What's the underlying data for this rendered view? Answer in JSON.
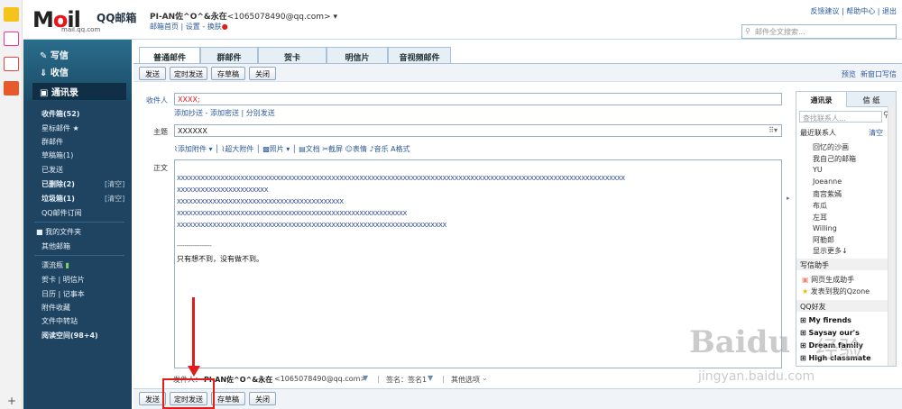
{
  "brand": {
    "logo_text_1": "M",
    "logo_o": "o",
    "logo_text_2": "il",
    "logo_sub": "mail.qq.com",
    "name": "QQ邮箱"
  },
  "account": {
    "nickname": "PI-AN佐^O^&永在",
    "email": "<1065078490@qq.com>",
    "links": [
      "邮箱首页",
      "设置",
      "换肤"
    ]
  },
  "top_links": [
    "反馈建议",
    "帮助中心",
    "退出"
  ],
  "search": {
    "placeholder": "邮件全文搜索..."
  },
  "sidebar": {
    "compose": "写信",
    "inbox": "收信",
    "contacts": "通讯录",
    "folders": [
      {
        "label": "收件箱(52)",
        "bold": true
      },
      {
        "label": "星标邮件 ★"
      },
      {
        "label": "群邮件"
      },
      {
        "label": "草稿箱(1)"
      },
      {
        "label": "已发送"
      },
      {
        "label": "已删除(2)",
        "bold": true,
        "tag": "[清空]"
      },
      {
        "label": "垃圾箱(1)",
        "bold": true,
        "tag": "[清空]"
      },
      {
        "label": "QQ邮件订阅"
      }
    ],
    "my_folders": [
      "我的文件夹",
      "其他邮箱"
    ],
    "tools": [
      "漂流瓶",
      "贺卡 | 明信片",
      "日历 | 记事本",
      "附件收藏",
      "文件中转站"
    ],
    "reading": "阅读空间(98+4)"
  },
  "tabs": [
    "普通邮件",
    "群邮件",
    "贺卡",
    "明信片",
    "音视频邮件"
  ],
  "toolbar": {
    "send": "发送",
    "timed_send": "定时发送",
    "save_draft": "存草稿",
    "close": "关闭",
    "preview": "预览",
    "new_window": "新窗口写信"
  },
  "form": {
    "to_label": "收件人",
    "to_value": "XXXX;",
    "cc_links": [
      "添加抄送",
      "添加密送",
      "分别发送"
    ],
    "subject_label": "主题",
    "subject_value": "XXXXXX",
    "attach_items": [
      "添加附件",
      "超大附件",
      "照片",
      "文档",
      "截屏",
      "表情",
      "音乐",
      "格式"
    ],
    "body_label": "正文",
    "body_lines": [
      "XXXXXXXXXXXXXXXXXXXXXXXXXXXXXXXXXXXXXXXXXXXXXXXXXXXXXXXXXXXXXXXXXXXXXXXXXXXXXXXXXXXXXXXXXXXXXXXXXXXXXXXXXXXXXXXXX",
      "XXXXXXXXXXXXXXXXXXXXXXX",
      "XXXXXXXXXXXXXXXXXXXXXXXXXXXXXXXXXXXXXXXXXX",
      "XXXXXXXXXXXXXXXXXXXXXXXXXXXXXXXXXXXXXXXXXXXXXXXXXXXXXXXXXX",
      "XXXXXXXXXXXXXXXXXXXXXXXXXXXXXXXXXXXXXXXXXXXXXXXXXXXXXXXXXXXXXXXXXXXX"
    ],
    "separator": "------------------",
    "signature": "只有想不到，没有做不到。"
  },
  "right_panel": {
    "tabs": [
      "通讯录",
      "信 纸"
    ],
    "search_placeholder": "查找联系人...",
    "recent_header": "最近联系人",
    "clear": "清空",
    "recent": [
      "回忆的沙画",
      "我自己的邮箱",
      "YU",
      "Joeanne",
      "南宫紫嫣",
      "布瓜",
      "左耳",
      "Willing",
      "阿勒郎"
    ],
    "show_more": "显示更多↓",
    "assistant_header": "写信助手",
    "assistant": [
      "网页生成助手",
      "发表到我的Qzone"
    ],
    "qq_header": "QQ好友",
    "groups": [
      "My firends",
      "Saysay our's",
      "Dream family",
      "High classmate"
    ]
  },
  "bottom": {
    "sender_label": "发件人：",
    "sender": "PI-AN佐^O^&永在",
    "sender_email": "<1065078490@qq.com>",
    "signature_label": "签名：签名1",
    "more_options": "其他选项"
  },
  "watermark": {
    "brand": "Baidu",
    "cn": "经验",
    "url": "jingyan.baidu.com"
  },
  "colors": {
    "sidebar": "#1f4462",
    "link": "#2d5a9b",
    "highlight": "#e21b1b"
  }
}
